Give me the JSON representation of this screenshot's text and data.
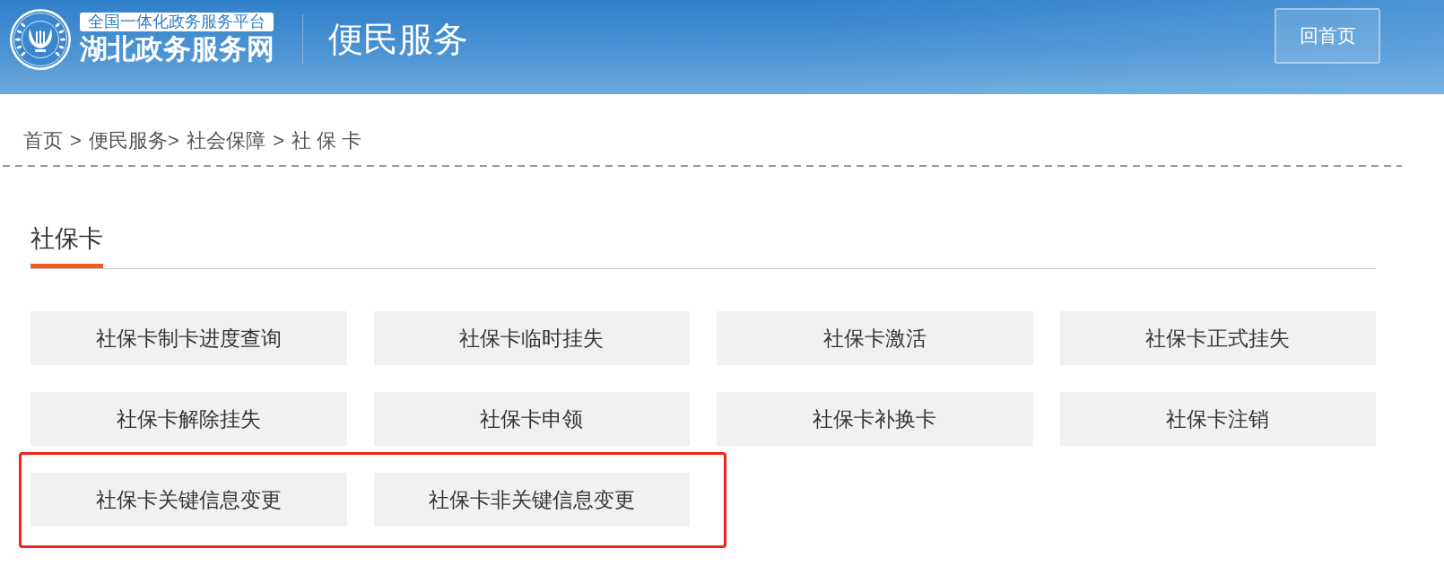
{
  "header": {
    "platform_badge": "全国一体化政务服务平台",
    "site_name": "湖北政务服务网",
    "section_title": "便民服务",
    "home_button": "回首页"
  },
  "breadcrumb": [
    {
      "label": "首页",
      "separator": " > "
    },
    {
      "label": "便民服务",
      "separator": "> "
    },
    {
      "label": "社会保障",
      "separator": " > "
    },
    {
      "label": "社 保 卡"
    }
  ],
  "tabs": [
    {
      "label": "社保卡",
      "selected": true
    }
  ],
  "services": [
    {
      "label": "社保卡制卡进度查询",
      "highlighted": false
    },
    {
      "label": "社保卡临时挂失",
      "highlighted": false
    },
    {
      "label": "社保卡激活",
      "highlighted": false
    },
    {
      "label": "社保卡正式挂失",
      "highlighted": false
    },
    {
      "label": "社保卡解除挂失",
      "highlighted": false
    },
    {
      "label": "社保卡申领",
      "highlighted": false
    },
    {
      "label": "社保卡补换卡",
      "highlighted": false
    },
    {
      "label": "社保卡注销",
      "highlighted": false
    },
    {
      "label": "社保卡关键信息变更",
      "highlighted": true
    },
    {
      "label": "社保卡非关键信息变更",
      "highlighted": true
    }
  ]
}
